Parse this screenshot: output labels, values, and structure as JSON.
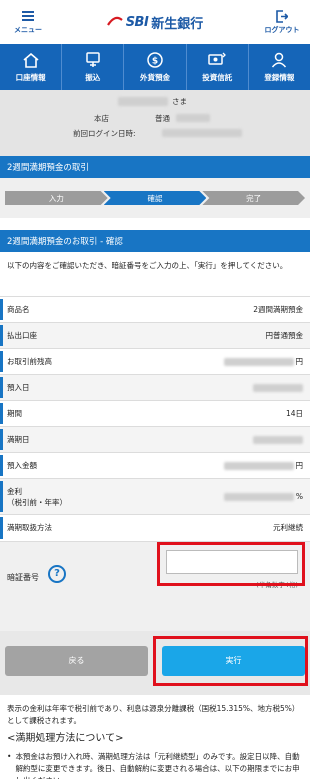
{
  "header": {
    "menu_label": "メニュー",
    "logo_mark": "SBI",
    "bank_name": "新生銀行",
    "logout_label": "ログアウト"
  },
  "nav": [
    {
      "label": "口座情報",
      "icon": "home-icon"
    },
    {
      "label": "振込",
      "icon": "transfer-icon"
    },
    {
      "label": "外貨預金",
      "icon": "currency-icon"
    },
    {
      "label": "投資信託",
      "icon": "investment-icon"
    },
    {
      "label": "登録情報",
      "icon": "profile-icon"
    }
  ],
  "user": {
    "honorific": "さま",
    "branch": "本店",
    "account_type": "普通",
    "last_login_label": "前回ログイン日時:"
  },
  "section_title": "2週間満期預金の取引",
  "steps": [
    "入力",
    "確認",
    "完了"
  ],
  "active_step": 1,
  "confirm_title": "2週間満期預金のお取引 - 確認",
  "instruction": "以下の内容をご確認いただき、暗証番号をご入力の上、「実行」を押してください。",
  "rows": [
    {
      "label": "商品名",
      "value": "2週間満期預金"
    },
    {
      "label": "払出口座",
      "value": "円普通預金"
    },
    {
      "label": "お取引前残高",
      "value": "",
      "unit": "円",
      "masked": true
    },
    {
      "label": "預入日",
      "value": "",
      "masked": true
    },
    {
      "label": "期間",
      "value": "14日"
    },
    {
      "label": "満期日",
      "value": "",
      "masked": true
    },
    {
      "label": "預入金額",
      "value": "",
      "unit": "円",
      "masked": true
    },
    {
      "label": "金利",
      "sublabel": "（税引前・年率）",
      "value": "",
      "unit": "%",
      "masked": true
    },
    {
      "label": "満期取扱方法",
      "value": "元利継続"
    }
  ],
  "pin": {
    "label": "暗証番号",
    "help": "?",
    "placeholder": "",
    "hint": "(半角数字4桁)"
  },
  "buttons": {
    "back": "戻る",
    "execute": "実行"
  },
  "footer": {
    "rate_note": "表示の金利は年率で税引前であり、利息は源泉分離課税（国税15.315%、地方税5%）として課税されます。",
    "heading": "<満期処理方法について>",
    "bullet": "本預金はお預け入れ時、満期処理方法は「元利継続型」のみです。設定日以降、自動解約型に変更できます。後日、自動解約に変更される場合は、以下の期限までにお申し出ください。"
  },
  "colors": {
    "brand": "#1d5aa6",
    "nav": "#1565b8",
    "section": "#1875c4",
    "highlight": "#e0101c",
    "execute": "#1aa6e8"
  }
}
